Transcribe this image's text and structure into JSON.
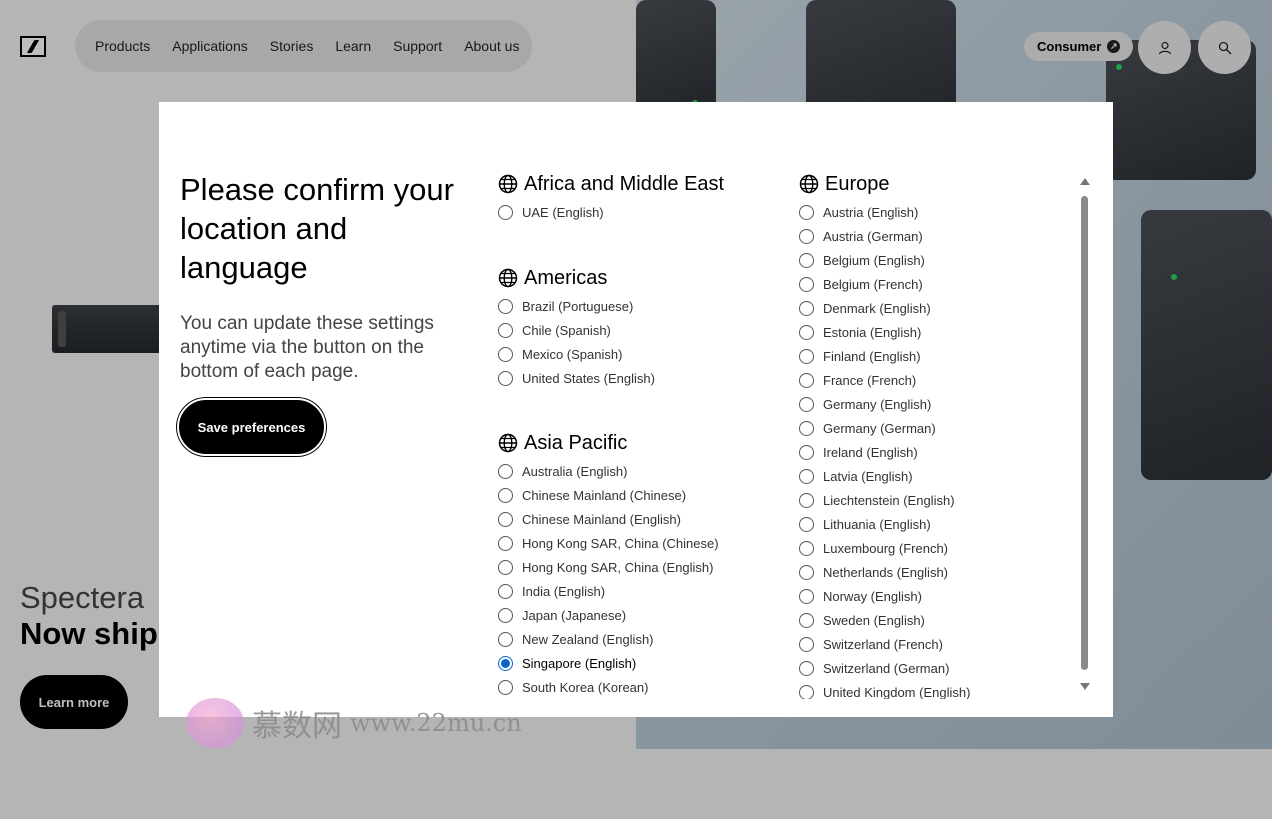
{
  "nav": {
    "links": [
      "Products",
      "Applications",
      "Stories",
      "Learn",
      "Support",
      "About us"
    ],
    "consumer_label": "Consumer"
  },
  "hero": {
    "title": "Spectera",
    "subtitle": "Now ship",
    "learn_more": "Learn more"
  },
  "modal": {
    "title": "Please confirm your location and language",
    "description": "You can update these settings anytime via the button on the bottom of each page.",
    "save_button": "Save preferences",
    "regions": [
      {
        "name": "Africa and Middle East",
        "options": [
          "UAE (English)"
        ]
      },
      {
        "name": "Americas",
        "options": [
          "Brazil (Portuguese)",
          "Chile (Spanish)",
          "Mexico (Spanish)",
          "United States (English)"
        ]
      },
      {
        "name": "Asia Pacific",
        "options": [
          "Australia (English)",
          "Chinese Mainland (Chinese)",
          "Chinese Mainland (English)",
          "Hong Kong SAR, China (Chinese)",
          "Hong Kong SAR, China (English)",
          "India (English)",
          "Japan (Japanese)",
          "New Zealand (English)",
          "Singapore (English)",
          "South Korea (Korean)"
        ]
      },
      {
        "name": "Europe",
        "options": [
          "Austria (English)",
          "Austria (German)",
          "Belgium (English)",
          "Belgium (French)",
          "Denmark (English)",
          "Estonia (English)",
          "Finland (English)",
          "France (French)",
          "Germany (English)",
          "Germany (German)",
          "Ireland (English)",
          "Latvia (English)",
          "Liechtenstein (English)",
          "Lithuania (English)",
          "Luxembourg (French)",
          "Netherlands (English)",
          "Norway (English)",
          "Sweden (English)",
          "Switzerland (French)",
          "Switzerland (German)",
          "United Kingdom (English)"
        ]
      }
    ],
    "selected": "Singapore (English)"
  },
  "watermark": {
    "text": "慕数网",
    "url": "www.22mu.cn"
  },
  "colors": {
    "accent": "#0b64c8",
    "button_bg": "#000000"
  }
}
